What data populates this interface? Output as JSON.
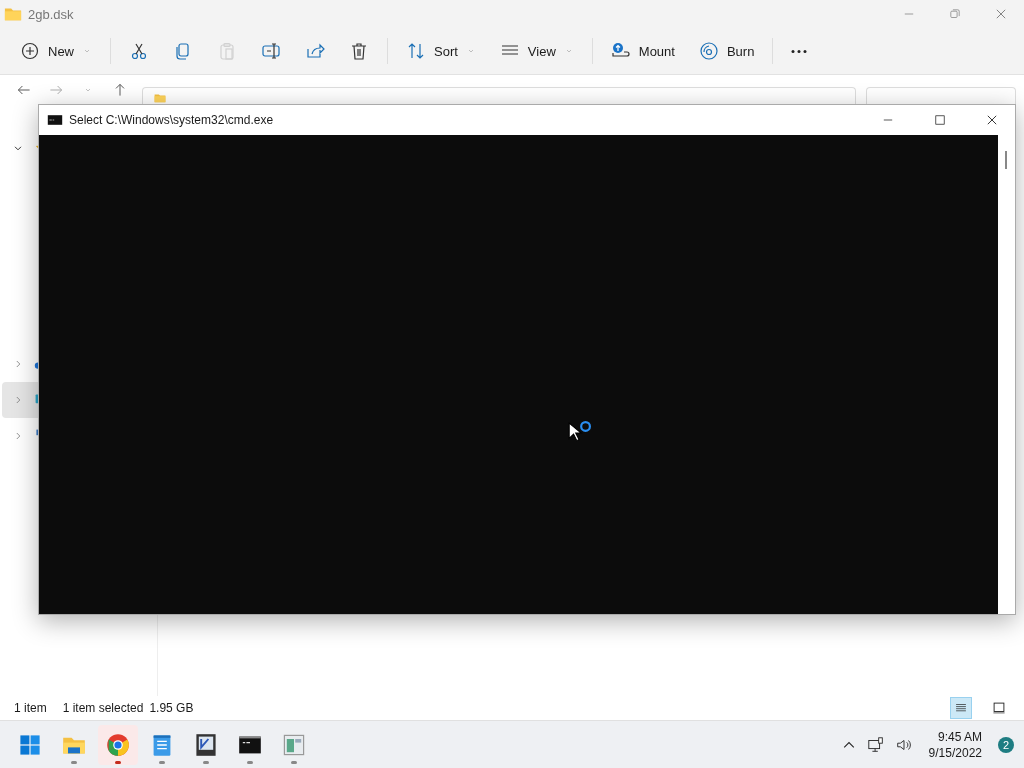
{
  "explorer": {
    "title": "2gb.dsk",
    "toolbar": [
      {
        "kind": "new",
        "label": "New",
        "disabled": false
      },
      {
        "kind": "cut",
        "disabled": false
      },
      {
        "kind": "copy",
        "disabled": false
      },
      {
        "kind": "paste",
        "disabled": true
      },
      {
        "kind": "rename",
        "disabled": false
      },
      {
        "kind": "share",
        "disabled": false
      },
      {
        "kind": "delete",
        "disabled": false
      },
      {
        "kind": "sort",
        "label": "Sort",
        "disabled": false
      },
      {
        "kind": "view",
        "label": "View",
        "disabled": false
      },
      {
        "kind": "mount",
        "label": "Mount",
        "disabled": false
      },
      {
        "kind": "burn",
        "label": "Burn",
        "disabled": false
      },
      {
        "kind": "more",
        "disabled": false
      }
    ],
    "sidebar": [
      {
        "kind": "star",
        "expanded": true,
        "selected": false
      },
      {
        "kind": "cloud",
        "expanded": false,
        "selected": false
      },
      {
        "kind": "pc",
        "expanded": false,
        "selected": true
      },
      {
        "kind": "network",
        "expanded": false,
        "selected": false
      }
    ],
    "status_bar": {
      "count": "1 item",
      "selection": "1 item selected",
      "size": "1.95 GB"
    },
    "view_toggles": [
      {
        "kind": "details",
        "selected": true
      },
      {
        "kind": "tiles",
        "selected": false
      }
    ]
  },
  "cmd_window": {
    "title": "Select C:\\Windows\\system32\\cmd.exe"
  },
  "taskbar": {
    "apps": [
      {
        "kind": "start",
        "running": false,
        "selected": false
      },
      {
        "kind": "explorer",
        "running": true,
        "selected": false
      },
      {
        "kind": "chrome",
        "running": true,
        "selected": true
      },
      {
        "kind": "notepad",
        "running": true,
        "selected": false
      },
      {
        "kind": "vm",
        "running": true,
        "selected": false
      },
      {
        "kind": "terminal",
        "running": true,
        "selected": false
      },
      {
        "kind": "app",
        "running": true,
        "selected": false
      }
    ],
    "time": "9:45 AM",
    "date": "9/15/2022",
    "notifications": "2"
  }
}
